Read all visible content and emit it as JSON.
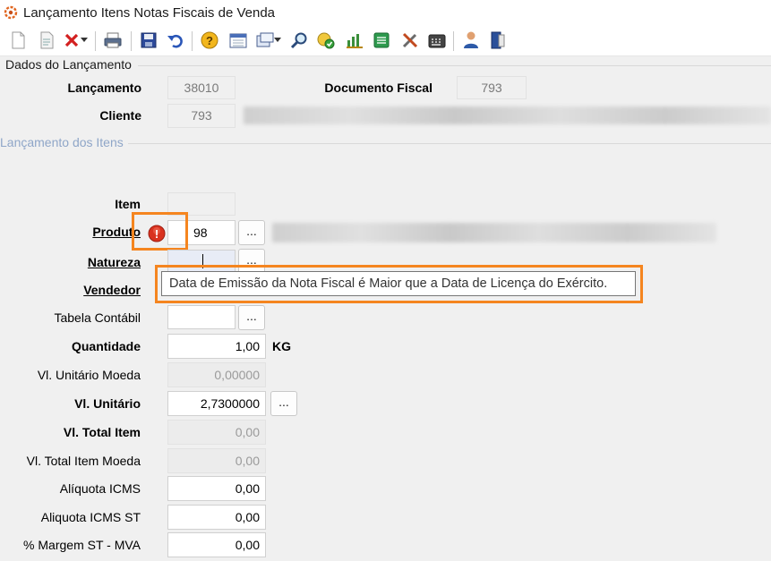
{
  "window": {
    "title": "Lançamento Itens Notas Fiscais de Venda"
  },
  "toolbar": {
    "icons": [
      "new-icon",
      "edit-icon",
      "delete-icon",
      "print-icon",
      "save-icon",
      "undo-icon",
      "help-icon",
      "calendar-icon",
      "window-icon",
      "search-icon",
      "approve-icon",
      "report-icon",
      "spreadsheet-icon",
      "tools-icon",
      "calculator-icon",
      "user-icon",
      "exit-icon"
    ]
  },
  "header": {
    "group_label": "Dados do Lançamento",
    "lancamento_label": "Lançamento",
    "lancamento_value": "38010",
    "documento_label": "Documento Fiscal",
    "documento_value": "793",
    "cliente_label": "Cliente",
    "cliente_value": "793"
  },
  "items": {
    "group_label": "Lançamento dos Itens",
    "item_label": "Item",
    "produto_label": "Produto",
    "produto_value": "98",
    "natureza_label": "Natureza",
    "vendedor_label": "Vendedor",
    "tabela_label": "Tabela Contábil",
    "quantidade_label": "Quantidade",
    "quantidade_value": "1,00",
    "quantidade_unit": "KG",
    "vl_unit_moeda_label": "Vl. Unitário Moeda",
    "vl_unit_moeda_value": "0,00000",
    "vl_unit_label": "Vl. Unitário",
    "vl_unit_value": "2,7300000",
    "vl_total_label": "Vl. Total Item",
    "vl_total_value": "0,00",
    "vl_total_moeda_label": "Vl. Total Item Moeda",
    "vl_total_moeda_value": "0,00",
    "aliq_icms_label": "Alíquota ICMS",
    "aliq_icms_value": "0,00",
    "aliq_icms_st_label": "Aliquota ICMS ST",
    "aliq_icms_st_value": "0,00",
    "margem_label": "% Margem ST - MVA",
    "margem_value": "0,00",
    "ellipsis": "..."
  },
  "tooltip": {
    "text": "Data de Emissão da Nota Fiscal é Maior que a Data de Licença do Exército."
  },
  "colors": {
    "highlight": "#f5851f",
    "error": "#d9321f"
  }
}
